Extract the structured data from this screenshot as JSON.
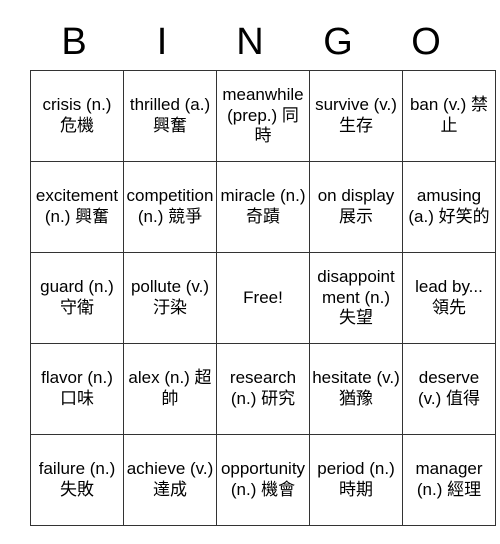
{
  "card": {
    "header_letters": [
      "B",
      "I",
      "N",
      "G",
      "O"
    ],
    "rows": [
      [
        {
          "text": "crisis (n.) 危機",
          "size": "lg"
        },
        {
          "text": "thrilled (a.) 興奮",
          "size": "lg"
        },
        {
          "text": "meanwhile (prep.) 同時",
          "size": "sm"
        },
        {
          "text": "survive (v.) 生存",
          "size": "lg"
        },
        {
          "text": "ban (v.) 禁止",
          "size": "lg"
        }
      ],
      [
        {
          "text": "excitement (n.) 興奮",
          "size": "sm"
        },
        {
          "text": "competition (n.) 競爭",
          "size": "sm"
        },
        {
          "text": "miracle (n.) 奇蹟",
          "size": "lg"
        },
        {
          "text": "on display 展示",
          "size": "lg"
        },
        {
          "text": "amusing (a.) 好笑的",
          "size": "lg"
        }
      ],
      [
        {
          "text": "guard (n.)守衛",
          "size": "lg"
        },
        {
          "text": "pollute (v.) 汙染",
          "size": "lg"
        },
        {
          "text": "Free!",
          "size": "xl"
        },
        {
          "text": "disappointment (n.) 失望",
          "size": "xs"
        },
        {
          "text": "lead by... 領先",
          "size": "lg"
        }
      ],
      [
        {
          "text": "flavor (n.) 口味",
          "size": "lg"
        },
        {
          "text": "alex (n.) 超帥",
          "size": "lg"
        },
        {
          "text": "research (n.) 研究",
          "size": "lg"
        },
        {
          "text": "hesitate (v.) 猶豫",
          "size": "lg"
        },
        {
          "text": "deserve (v.) 值得",
          "size": "lg"
        }
      ],
      [
        {
          "text": "failure (n.) 失敗",
          "size": "lg"
        },
        {
          "text": "achieve (v.) 達成",
          "size": "lg"
        },
        {
          "text": "opportunity (n.) 機會",
          "size": "sm"
        },
        {
          "text": "period (n.) 時期",
          "size": "lg"
        },
        {
          "text": "manager (n.) 經理",
          "size": "lg"
        }
      ]
    ],
    "colors": {
      "border": "#333333",
      "text": "#000000",
      "background": "#ffffff"
    }
  }
}
